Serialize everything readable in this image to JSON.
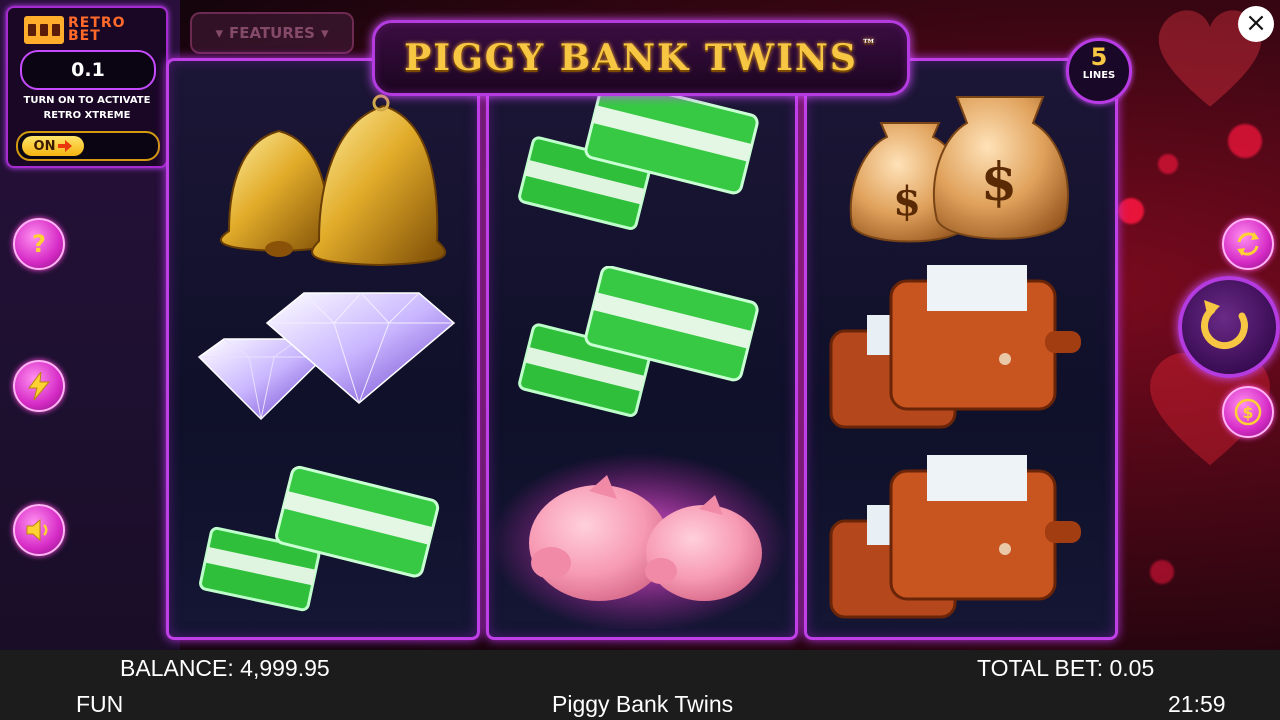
{
  "retro_bet": {
    "logo_line1": "RETRO",
    "logo_line2": "BET",
    "value": "0.1",
    "caption_line1": "TURN ON TO ACTIVATE",
    "caption_line2": "RETRO XTREME",
    "toggle_label": "ON"
  },
  "features_tab": {
    "label": "FEATURES"
  },
  "game_title": {
    "text": "PIGGY BANK TWINS",
    "trademark": "™"
  },
  "lines_badge": {
    "number": "5",
    "label": "LINES"
  },
  "reels": [
    [
      "double-bell-symbol",
      "double-diamond-symbol",
      "double-cash-stack-symbol"
    ],
    [
      "double-cash-stack-symbol",
      "double-cash-stack-symbol",
      "piggy-bank-twins-symbol"
    ],
    [
      "double-money-bag-symbol",
      "double-wallet-symbol",
      "double-wallet-symbol"
    ]
  ],
  "side_buttons": {
    "help_glyph": "?",
    "turbo_icon": "lightning-icon",
    "sound_icon": "speaker-icon",
    "autoplay_icon": "autoplay-icon",
    "spin_icon": "spin-arrow-icon",
    "bet_icon": "coin-icon"
  },
  "close_glyph": "×",
  "status_bar": {
    "balance": "BALANCE: 4,999.95",
    "total_bet": "TOTAL BET: 0.05",
    "mode": "FUN",
    "game_name": "Piggy Bank Twins",
    "clock": "21:59"
  },
  "colors": {
    "accent_purple": "#c040e8",
    "gold": "#f7c643",
    "bottom_bar": "#1c1c1c"
  }
}
